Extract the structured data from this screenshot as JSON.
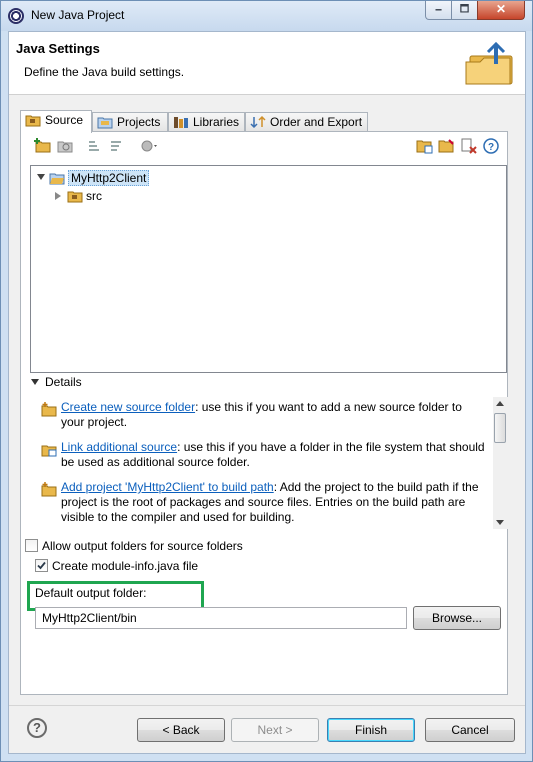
{
  "window": {
    "title": "New Java Project",
    "min": "🗕",
    "max": "🗖",
    "close": "✕"
  },
  "banner": {
    "heading": "Java Settings",
    "description": "Define the Java build settings."
  },
  "tabs": [
    {
      "label": "Source",
      "icon": "source-folder-icon"
    },
    {
      "label": "Projects",
      "icon": "projects-icon"
    },
    {
      "label": "Libraries",
      "icon": "libraries-icon"
    },
    {
      "label": "Order and Export",
      "icon": "order-export-icon"
    }
  ],
  "tree": {
    "project": "MyHttp2Client",
    "child": "src"
  },
  "details": {
    "header": "Details",
    "items": [
      {
        "link": "Create new source folder",
        "text": ": use this if you want to add a new source folder to your project."
      },
      {
        "link": "Link additional source",
        "text": ": use this if you have a folder in the file system that should be used as additional source folder."
      },
      {
        "link": "Add project 'MyHttp2Client' to build path",
        "text": ": Add the project to the build path if the project is the root of packages and source files. Entries on the build path are visible to the compiler and used for building."
      }
    ]
  },
  "options": {
    "allow_output": {
      "label": "Allow output folders for source folders",
      "checked": false
    },
    "create_module": {
      "label": "Create module-info.java file",
      "checked": true
    }
  },
  "output": {
    "label": "Default output folder:",
    "value": "MyHttp2Client/bin",
    "browse": "Browse..."
  },
  "buttons": {
    "back": "< Back",
    "next": "Next >",
    "finish": "Finish",
    "cancel": "Cancel"
  },
  "colors": {
    "highlight_box": "#1fa650",
    "link": "#0b5fbd"
  }
}
